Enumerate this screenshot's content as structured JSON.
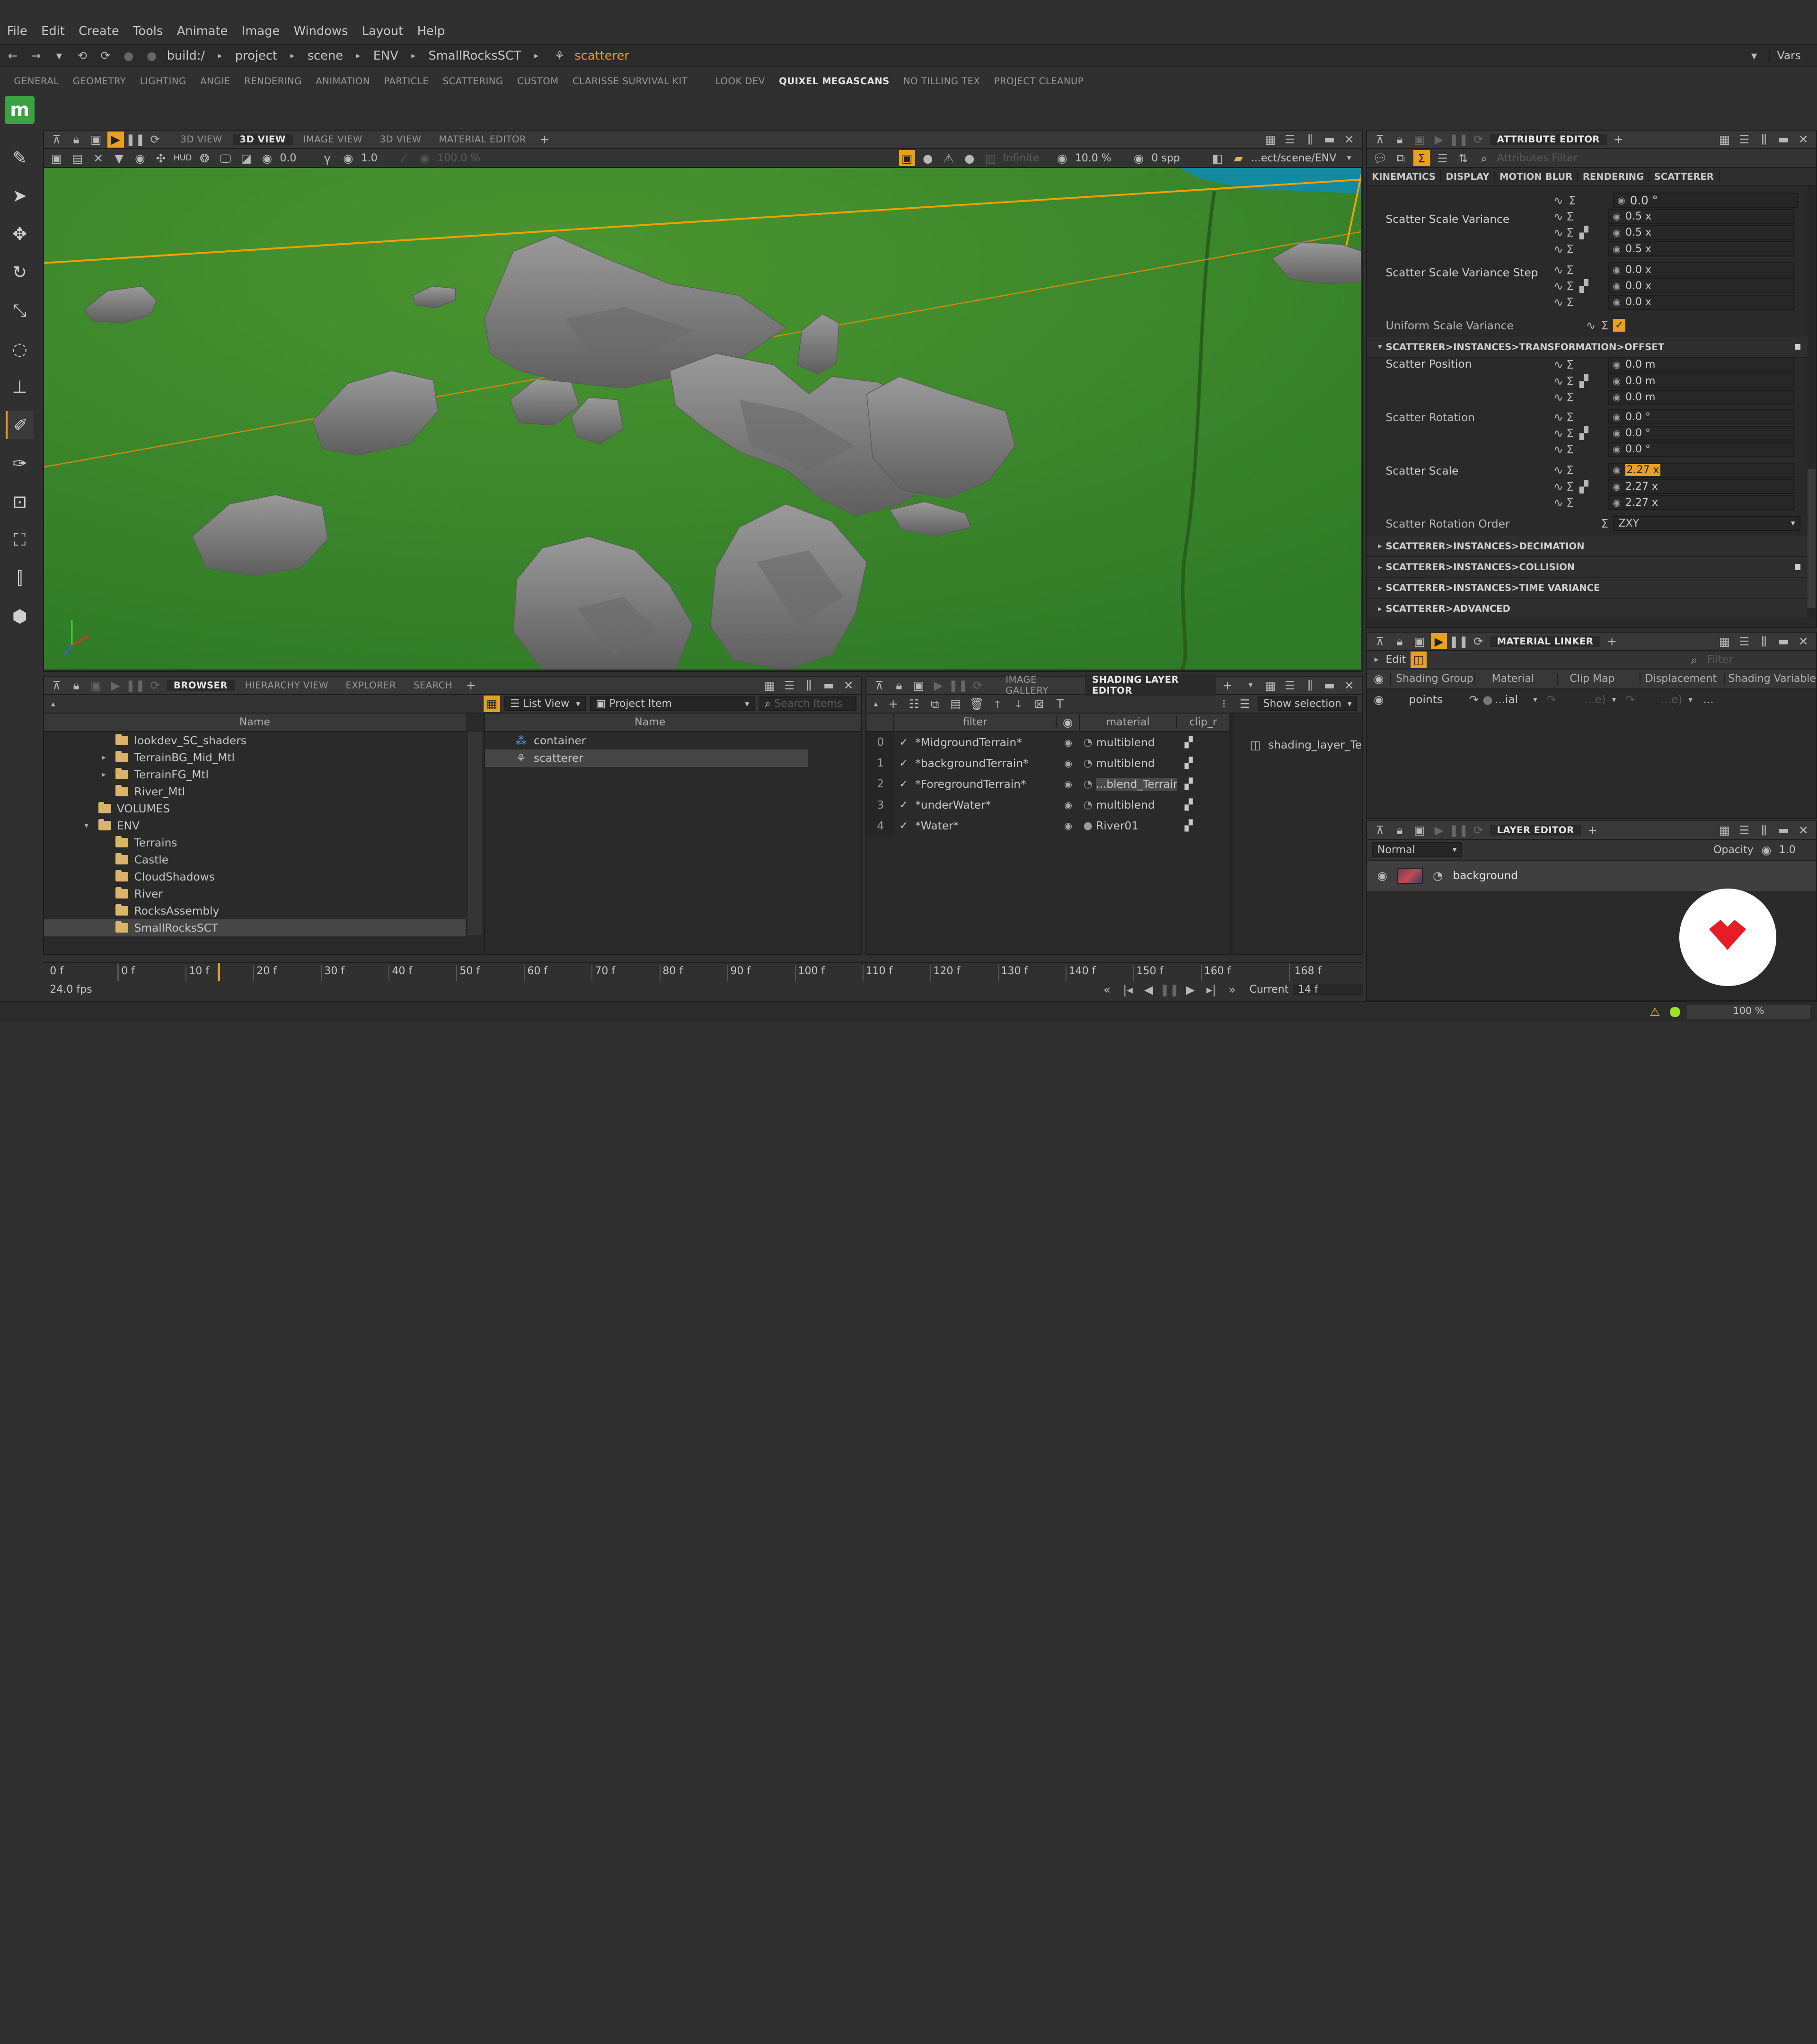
{
  "menu": [
    "File",
    "Edit",
    "Create",
    "Tools",
    "Animate",
    "Image",
    "Windows",
    "Layout",
    "Help"
  ],
  "path_bar": {
    "segments": [
      "build:/",
      "project",
      "scene",
      "ENV",
      "SmallRocksSCT"
    ],
    "current": "scatterer",
    "vars_label": "Vars"
  },
  "shelf_tabs": [
    "GENERAL",
    "GEOMETRY",
    "LIGHTING",
    "ANGIE",
    "RENDERING",
    "ANIMATION",
    "PARTICLE",
    "SCATTERING",
    "CUSTOM",
    "CLARISSE SURVIVAL KIT",
    "LOOK DEV",
    "QUIXEL MEGASCANS",
    "NO TILLING TEX",
    "PROJECT CLEANUP"
  ],
  "shelf_active": "QUIXEL MEGASCANS",
  "logo_letter": "m",
  "viewport": {
    "tabs": [
      "3D VIEW",
      "3D VIEW",
      "IMAGE VIEW",
      "3D VIEW",
      "MATERIAL EDITOR"
    ],
    "active_tab_index": 1,
    "hud": "HUD",
    "exposure": "0.0",
    "gamma": "1.0",
    "opacity": "100.0 %",
    "lod": "Infinite",
    "sampling": "10.0 %",
    "spp": "0 spp",
    "path": "...ect/scene/ENV"
  },
  "attribute_editor": {
    "title": "ATTRIBUTE EDITOR",
    "filter_placeholder": "Attributes Filter",
    "sub_tabs": [
      "KINEMATICS",
      "DISPLAY",
      "MOTION BLUR",
      "RENDERING",
      "SCATTERER"
    ],
    "top_value": "0.0 °",
    "scale_variance_label": "Scatter Scale Variance",
    "scale_variance": [
      "0.5 x",
      "0.5 x",
      "0.5 x"
    ],
    "scale_variance_step_label": "Scatter Scale Variance Step",
    "scale_variance_step": [
      "0.0 x",
      "0.0 x",
      "0.0 x"
    ],
    "uniform_label": "Uniform Scale Variance",
    "offset_section": "SCATTERER>INSTANCES>TRANSFORMATION>OFFSET",
    "position_label": "Scatter Position",
    "position": [
      "0.0 m",
      "0.0 m",
      "0.0 m"
    ],
    "rotation_label": "Scatter Rotation",
    "rotation": [
      "0.0 °",
      "0.0 °",
      "0.0 °"
    ],
    "scale_label": "Scatter Scale",
    "scale": [
      "2.27 x",
      "2.27 x",
      "2.27 x"
    ],
    "rotation_order_label": "Scatter Rotation Order",
    "rotation_order": "ZXY",
    "sections": [
      "SCATTERER>INSTANCES>DECIMATION",
      "SCATTERER>INSTANCES>COLLISION",
      "SCATTERER>INSTANCES>TIME VARIANCE",
      "SCATTERER>ADVANCED"
    ]
  },
  "material_linker": {
    "title": "MATERIAL LINKER",
    "edit_label": "Edit",
    "filter_placeholder": "Filter",
    "columns": [
      "Shading Group",
      "Material",
      "Clip Map",
      "Displacement",
      "Shading Variable"
    ],
    "row": {
      "group": "points",
      "material": "...ial",
      "clip": "...e)",
      "disp": "...e)",
      "var": "..."
    }
  },
  "layer_editor": {
    "title": "LAYER EDITOR",
    "blend_mode": "Normal",
    "opacity_label": "Opacity",
    "opacity_value": "1.0",
    "layer_name": "background"
  },
  "browser": {
    "tabs": [
      "BROWSER",
      "HIERARCHY VIEW",
      "EXPLORER",
      "SEARCH"
    ],
    "name_header": "Name",
    "tree": [
      {
        "label": "lookdev_SC_shaders",
        "indent": 4,
        "arrow": false
      },
      {
        "label": "TerrainBG_Mid_Mtl",
        "indent": 4,
        "arrow": true
      },
      {
        "label": "TerrainFG_Mtl",
        "indent": 4,
        "arrow": true
      },
      {
        "label": "River_Mtl",
        "indent": 4,
        "arrow": false
      },
      {
        "label": "VOLUMES",
        "indent": 3,
        "arrow": false
      },
      {
        "label": "ENV",
        "indent": 3,
        "arrow": true,
        "open": true
      },
      {
        "label": "Terrains",
        "indent": 4,
        "arrow": false
      },
      {
        "label": "Castle",
        "indent": 4,
        "arrow": false
      },
      {
        "label": "CloudShadows",
        "indent": 4,
        "arrow": false
      },
      {
        "label": "River",
        "indent": 4,
        "arrow": false
      },
      {
        "label": "RocksAssembly",
        "indent": 4,
        "arrow": false
      },
      {
        "label": "SmallRocksSCT",
        "indent": 4,
        "arrow": false,
        "selected": true
      }
    ],
    "view_mode": "List View",
    "item_type": "Project Item",
    "search_placeholder": "Search Items",
    "items": [
      "container",
      "scatterer"
    ]
  },
  "shading_layer": {
    "tabs": [
      "IMAGE GALLERY",
      "SHADING LAYER EDITOR"
    ],
    "show_selection": "Show selection",
    "columns": [
      "filter",
      "material",
      "clip_r"
    ],
    "rows": [
      {
        "idx": "0",
        "filter": "*MidgroundTerrain*",
        "material": "multiblend"
      },
      {
        "idx": "1",
        "filter": "*backgroundTerrain*",
        "material": "multiblend"
      },
      {
        "idx": "2",
        "filter": "*ForegroundTerrain*",
        "material": "...blend_Terrain"
      },
      {
        "idx": "3",
        "filter": "*underWater*",
        "material": "multiblend"
      },
      {
        "idx": "4",
        "filter": "*Water*",
        "material": "River01"
      }
    ],
    "side_item": "shading_layer_Te"
  },
  "timeline": {
    "start": "0 f",
    "fps": "24.0 fps",
    "ticks": [
      "0 f",
      "10 f",
      "20 f",
      "30 f",
      "40 f",
      "50 f",
      "60 f",
      "70 f",
      "80 f",
      "90 f",
      "100 f",
      "110 f",
      "120 f",
      "130 f",
      "140 f",
      "150 f",
      "160 f"
    ],
    "end": "168 f",
    "current_label": "Current",
    "current_value": "14 f"
  },
  "status": {
    "zoom": "100 %"
  },
  "colors": {
    "accent": "#e8a020",
    "grass": "#3c8a2a",
    "rock": "#7d7d7d",
    "panel": "#2a2a2a"
  }
}
